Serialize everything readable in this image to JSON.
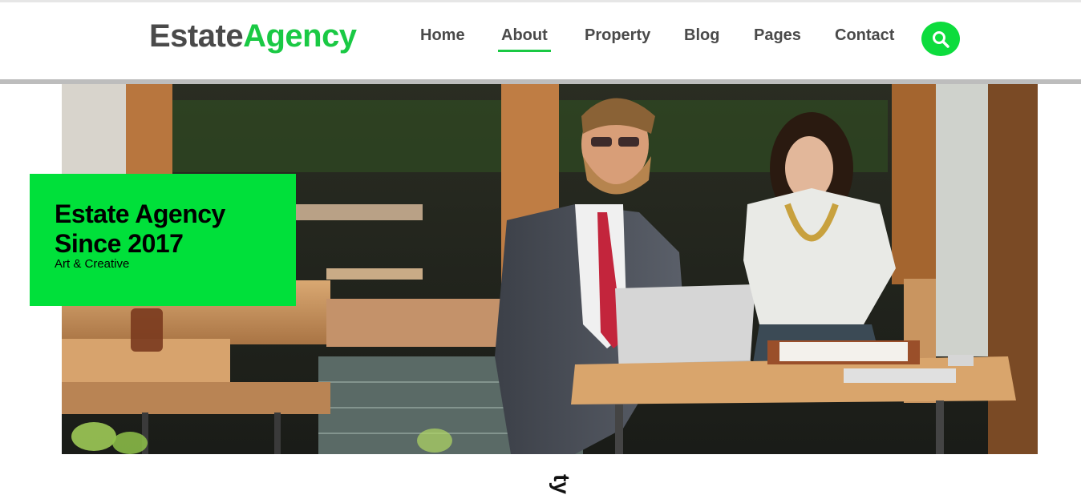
{
  "header": {
    "logo": {
      "part1": "Estate",
      "part2": "Agency"
    },
    "nav": [
      {
        "label": "Home"
      },
      {
        "label": "About",
        "active": true
      },
      {
        "label": "Property"
      },
      {
        "label": "Blog"
      },
      {
        "label": "Pages"
      },
      {
        "label": "Contact"
      }
    ],
    "search_icon": "search-icon"
  },
  "hero": {
    "title": "Estate Agency Since 2017",
    "subtitle": "Art & Creative"
  },
  "below_hero": {
    "partial_text": "ty"
  },
  "colors": {
    "accent": "#1ac944",
    "hero_box": "#00e03a",
    "nav_text": "#4a4a4a"
  }
}
